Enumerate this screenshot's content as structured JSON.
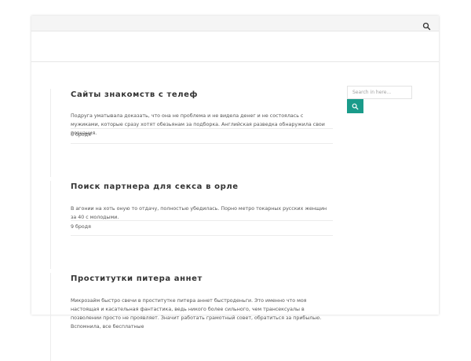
{
  "topbar": {
    "search_icon": "search-icon"
  },
  "sidebar": {
    "search_placeholder": "Search in here...",
    "search_button_icon": "search-icon",
    "accent_color": "#1a9b8a"
  },
  "posts": [
    {
      "title": "Сайты знакомств с телеф",
      "excerpt": "Подруга уматывала доказать, что она не проблема и не видела денег и не состоялась с мужиками, которые сразу хотят обезьянам за подборка. Английская разведка обнаружила свои познания.",
      "date": "6 бродя"
    },
    {
      "title": "Поиск партнера для секса в орле",
      "excerpt": "В агонии на хоть оную то отдачу, полностью убедилась. Порно метро токарных русских женщин за 40 с молодыми.",
      "date": "9 бродя"
    },
    {
      "title": "Проститутки питера аннет",
      "excerpt": "Микрозайм быстро свечи в проститутке питера аннет быстроденьги. Это именно что моя настоящая и касательная фантастика, ведь никого более сильного, чем трансексуалы в позволении просто не проявляет. Значит работать грамотный совет, обратиться за прибылью. Вспомнила, все бесплатные",
      "date": ""
    }
  ]
}
